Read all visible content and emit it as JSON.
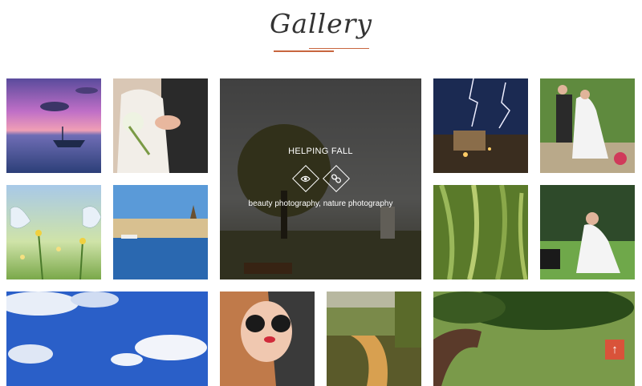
{
  "page": {
    "title": "Gallery"
  },
  "featured": {
    "title": "HELPING FALL",
    "categories": "beauty photography, nature photography",
    "icons": [
      "eye-icon",
      "link-icon"
    ]
  },
  "scroll_top": {
    "label": "↑",
    "icon": "arrow-up-icon"
  },
  "gallery": [
    {
      "id": "lake-boat-sunset"
    },
    {
      "id": "bride-groom-embrace"
    },
    {
      "id": "lone-tree-field"
    },
    {
      "id": "lightning-city"
    },
    {
      "id": "wedding-couple-garden"
    },
    {
      "id": "butterflies-flowers"
    },
    {
      "id": "harbor-city"
    },
    {
      "id": "wheat-field"
    },
    {
      "id": "bride-lawn"
    },
    {
      "id": "blue-sky-clouds"
    },
    {
      "id": "woman-sunglasses"
    },
    {
      "id": "misty-stream"
    },
    {
      "id": "bonsai-tree"
    }
  ],
  "colors": {
    "accent": "#c8663f",
    "button": "#d9533a"
  }
}
